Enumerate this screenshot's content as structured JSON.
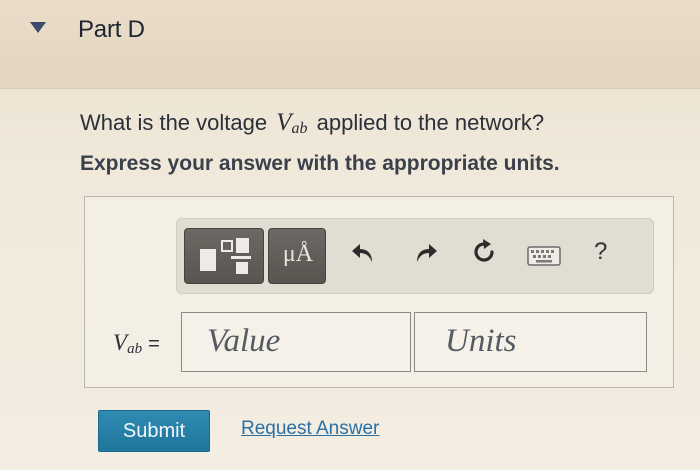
{
  "part": {
    "title": "Part D"
  },
  "question": {
    "prefix": "What is the voltage",
    "variable": "V",
    "variable_subscript": "ab",
    "suffix": "applied to the network?"
  },
  "instruction": "Express your answer with the appropriate units.",
  "toolbar": {
    "templates_icon": "templates-icon",
    "units_label": "μÅ",
    "undo_icon": "undo-icon",
    "redo_icon": "redo-icon",
    "reset_icon": "reset-icon",
    "keyboard_icon": "keyboard-icon",
    "help_label": "?"
  },
  "answer": {
    "variable": "V",
    "variable_subscript": "ab",
    "equals": "=",
    "value_placeholder": "Value",
    "units_placeholder": "Units"
  },
  "actions": {
    "submit_label": "Submit",
    "request_answer_label": "Request Answer"
  },
  "colors": {
    "submit_bg": "#1f759c",
    "link": "#2a6fa4",
    "toolbar_button": "#5d5954"
  }
}
